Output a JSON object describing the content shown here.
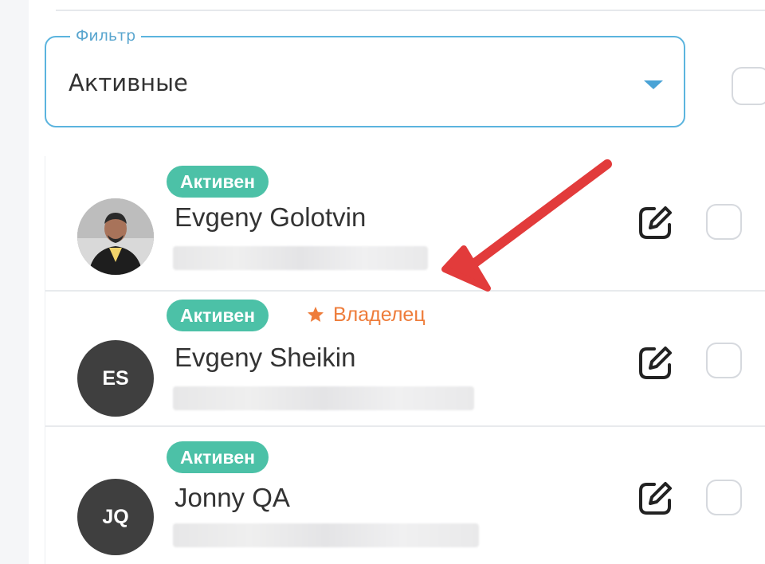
{
  "filter": {
    "label": "Фильтр",
    "value": "Активные"
  },
  "users": [
    {
      "status": "Активен",
      "name": "Evgeny Golotvin",
      "initials": "",
      "has_photo": true,
      "owner_label": ""
    },
    {
      "status": "Активен",
      "name": "Evgeny Sheikin",
      "initials": "ES",
      "has_photo": false,
      "owner_label": "Владелец"
    },
    {
      "status": "Активен",
      "name": "Jonny QA",
      "initials": "JQ",
      "has_photo": false,
      "owner_label": ""
    }
  ],
  "icons": {
    "dropdown": "triangle-down",
    "edit": "edit-square-pen",
    "owner": "star",
    "annotation": "red-arrow"
  },
  "colors": {
    "accent_blue": "#5bb4de",
    "status_green": "#4cc1a7",
    "owner_orange": "#ee7c3a",
    "arrow_red": "#e23b3b"
  }
}
